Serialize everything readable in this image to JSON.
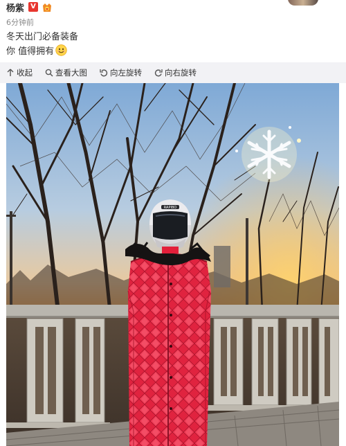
{
  "user": {
    "name": "杨紫",
    "verified_badge": "V"
  },
  "post": {
    "time": "6分钟前",
    "lines": [
      "冬天出门必备装备",
      "你 值得拥有"
    ]
  },
  "toolbar": {
    "collapse": "收起",
    "view_large": "查看大图",
    "rotate_left": "向左旋转",
    "rotate_right": "向右旋转"
  },
  "photo": {
    "helmet_text": "RAPIBO"
  },
  "colors": {
    "accent_red": "#e8362f",
    "toolbar_bg": "#f2f2f5",
    "coat": "#e0233f"
  },
  "icons": [
    "verified-v-icon",
    "medal-icon",
    "collapse-icon",
    "search-icon",
    "rotate-left-icon",
    "rotate-right-icon",
    "smile-emoji-icon"
  ]
}
